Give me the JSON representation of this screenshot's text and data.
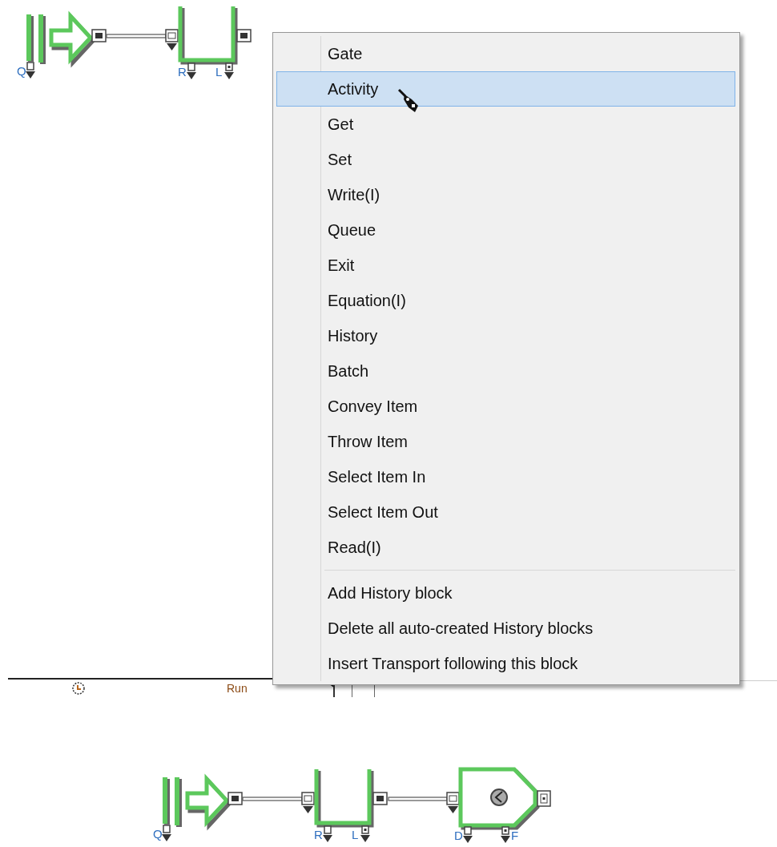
{
  "top_diagram": {
    "blocks": [
      {
        "kind": "source",
        "ports": [
          "Q"
        ]
      },
      {
        "kind": "queue",
        "ports": [
          "R",
          "L"
        ]
      }
    ]
  },
  "context_menu": {
    "sections": [
      {
        "items": [
          {
            "label": "Gate",
            "selected": false
          },
          {
            "label": "Activity",
            "selected": true
          },
          {
            "label": "Get",
            "selected": false
          },
          {
            "label": "Set",
            "selected": false
          },
          {
            "label": "Write(I)",
            "selected": false
          },
          {
            "label": "Queue",
            "selected": false
          },
          {
            "label": "Exit",
            "selected": false
          },
          {
            "label": "Equation(I)",
            "selected": false
          },
          {
            "label": "History",
            "selected": false
          },
          {
            "label": "Batch",
            "selected": false
          },
          {
            "label": "Convey Item",
            "selected": false
          },
          {
            "label": "Throw Item",
            "selected": false
          },
          {
            "label": "Select Item In",
            "selected": false
          },
          {
            "label": "Select Item Out",
            "selected": false
          },
          {
            "label": "Read(I)",
            "selected": false
          }
        ]
      },
      {
        "items": [
          {
            "label": "Add History block",
            "selected": false
          },
          {
            "label": "Delete all auto-created History blocks",
            "selected": false
          },
          {
            "label": "Insert Transport following this block",
            "selected": false
          }
        ]
      }
    ]
  },
  "status_bar": {
    "run_label": "Run"
  },
  "bottom_diagram": {
    "blocks": [
      {
        "kind": "source",
        "ports": [
          "Q"
        ]
      },
      {
        "kind": "queue",
        "ports": [
          "R",
          "L"
        ]
      },
      {
        "kind": "activity",
        "ports": [
          "D",
          "F"
        ]
      }
    ]
  }
}
